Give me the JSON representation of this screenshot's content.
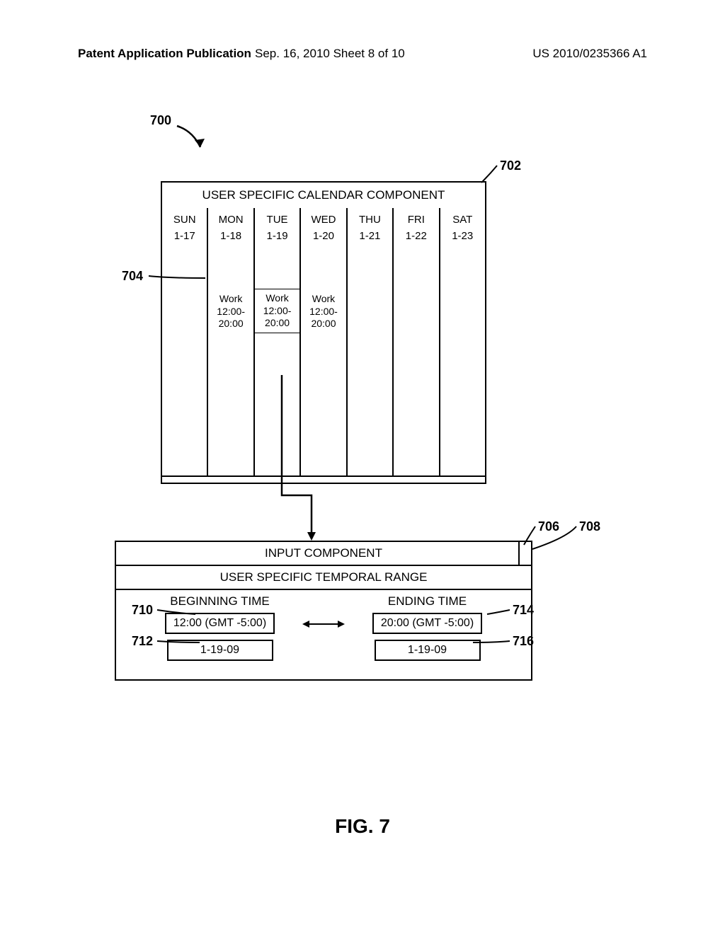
{
  "header": {
    "left": "Patent Application Publication",
    "mid": "Sep. 16, 2010  Sheet 8 of 10",
    "right": "US 2010/0235366 A1"
  },
  "labels": {
    "l700": "700",
    "l702": "702",
    "l704": "704",
    "l706": "706",
    "l708": "708",
    "l710": "710",
    "l712": "712",
    "l714": "714",
    "l716": "716"
  },
  "calendar": {
    "title": "USER SPECIFIC CALENDAR COMPONENT",
    "cols": [
      {
        "day": "SUN",
        "date": "1-17",
        "event": null
      },
      {
        "day": "MON",
        "date": "1-18",
        "event": "Work 12:00- 20:00"
      },
      {
        "day": "TUE",
        "date": "1-19",
        "event": "Work 12:00- 20:00"
      },
      {
        "day": "WED",
        "date": "1-20",
        "event": "Work 12:00- 20:00"
      },
      {
        "day": "THU",
        "date": "1-21",
        "event": null
      },
      {
        "day": "FRI",
        "date": "1-22",
        "event": null
      },
      {
        "day": "SAT",
        "date": "1-23",
        "event": null
      }
    ]
  },
  "input": {
    "title": "INPUT COMPONENT",
    "subtitle": "USER SPECIFIC TEMPORAL RANGE",
    "begin_label": "BEGINNING TIME",
    "end_label": "ENDING TIME",
    "begin_time": "12:00 (GMT -5:00)",
    "end_time": "20:00 (GMT -5:00)",
    "begin_date": "1-19-09",
    "end_date": "1-19-09"
  },
  "figure": "FIG. 7"
}
